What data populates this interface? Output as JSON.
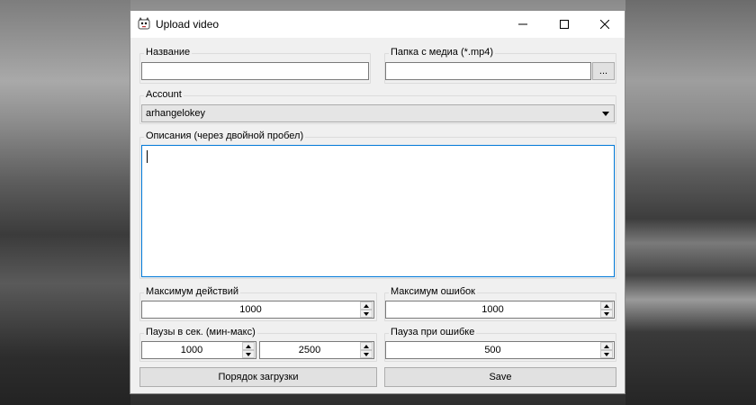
{
  "window": {
    "title": "Upload video",
    "icon": "app-cat-icon"
  },
  "titlebar_buttons": {
    "minimize": "—",
    "maximize": "☐",
    "close": "✕"
  },
  "fields": {
    "name_label": "Название",
    "name_value": "",
    "media_label": "Папка с медиа (*.mp4)",
    "media_value": "",
    "browse_label": "...",
    "account_label": "Account",
    "account_value": "arhangelokey",
    "description_label": "Описания (через двойной пробел)",
    "description_value": "",
    "max_actions_label": "Максимум действий",
    "max_actions_value": "1000",
    "max_errors_label": "Максимум ошибок",
    "max_errors_value": "1000",
    "pauses_label": "Паузы в сек. (мин-макс)",
    "pause_min_value": "1000",
    "pause_max_value": "2500",
    "error_pause_label": "Пауза при ошибке",
    "error_pause_value": "500"
  },
  "buttons": {
    "upload_order": "Порядок загрузки",
    "save": "Save"
  }
}
